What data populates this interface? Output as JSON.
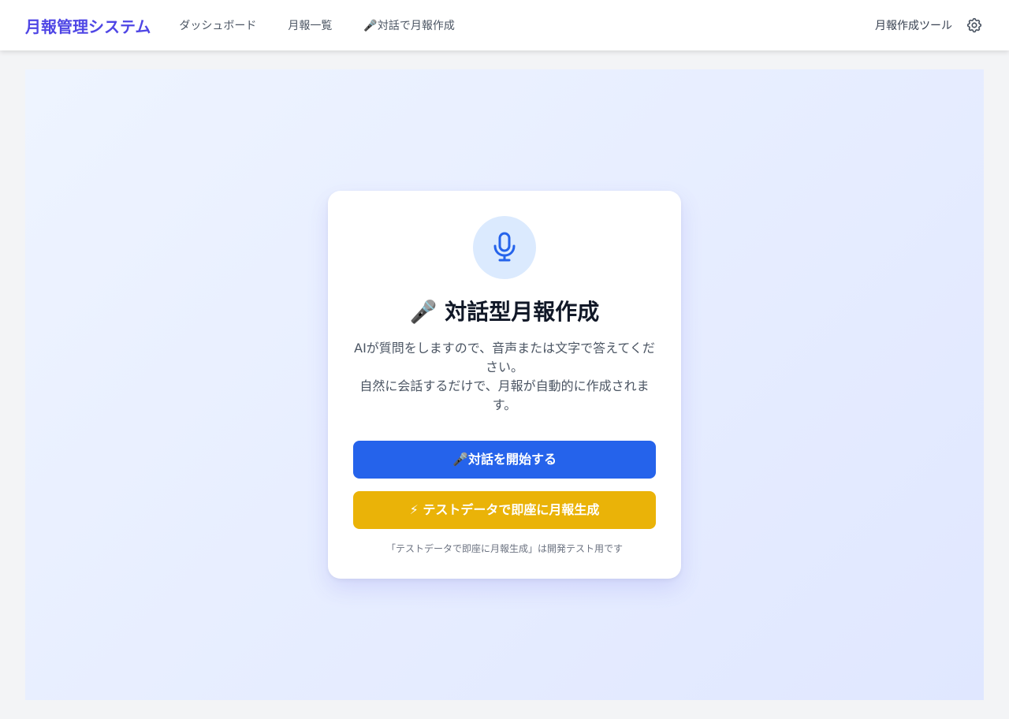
{
  "navbar": {
    "brand": "月報管理システム",
    "links": [
      "ダッシュボード",
      "月報一覧",
      "🎤対話で月報作成"
    ],
    "tool_label": "月報作成ツール",
    "settings_icon": "gear-icon"
  },
  "card": {
    "icon": "microphone-icon",
    "title": "🎤 対話型月報作成",
    "description_line1": "AIが質問をしますので、音声または文字で答えてください。",
    "description_line2": "自然に会話するだけで、月報が自動的に作成されます。",
    "start_button": "🎤対話を開始する",
    "test_button": "⚡ テストデータで即座に月報生成",
    "note": "「テストデータで即座に月報生成」は開発テスト用です"
  },
  "colors": {
    "brand": "#4f46e5",
    "primary_button": "#2563eb",
    "test_button": "#eab308",
    "mic_circle": "#dbeafe"
  }
}
